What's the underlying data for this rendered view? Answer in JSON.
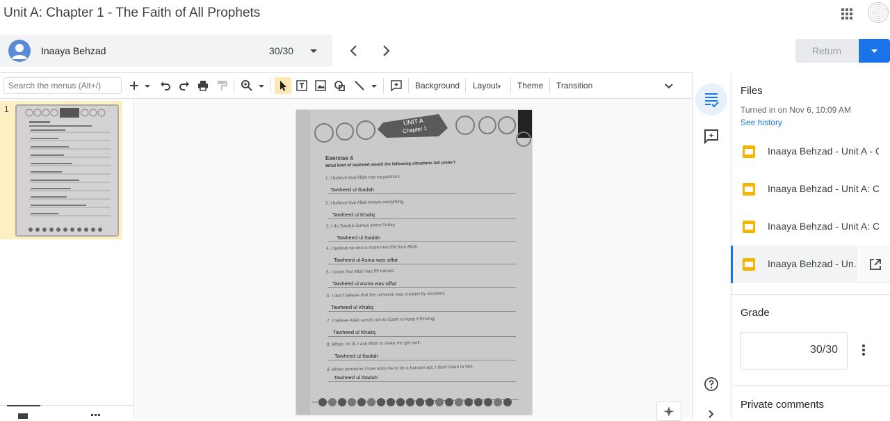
{
  "header": {
    "title": "Unit A: Chapter 1 - The Faith of All Prophets"
  },
  "student": {
    "name": "Inaaya Behzad",
    "score": "30/30"
  },
  "actions": {
    "return_label": "Return"
  },
  "toolbar": {
    "search_placeholder": "Search the menus (Alt+/)",
    "background": "Background",
    "layout": "Layout",
    "theme": "Theme",
    "transition": "Transition"
  },
  "filmstrip": {
    "slide_number": "1"
  },
  "worksheet": {
    "badge_line1": "UNIT A",
    "badge_line2": "Chapter 1",
    "exercise_title": "Exercise 4",
    "question": "What kind of tawheed would the following situations fall under?",
    "items": [
      {
        "q": "1. I believe that Allah has no partners.",
        "a": "Tawheed ul Ibadah"
      },
      {
        "q": "2. I believe that Allah knows everything.",
        "a": "Tawheed ul Khaliq"
      },
      {
        "q": "3. I do Salatul-Jumua every Friday.",
        "a": "Tawheed ul Ibadah"
      },
      {
        "q": "4. I believe no one is more merciful than Allah.",
        "a": "Tawheed ul Asma was siffat"
      },
      {
        "q": "5. I know that Allah has 99 names.",
        "a": "Tawheed ul Asma was siffat"
      },
      {
        "q": "6. I don't believe that the universe was created by accident.",
        "a": "Tawheed ul Khaliq"
      },
      {
        "q": "7. I believe Allah sends rain to Earth to keep it thriving.",
        "a": "Tawheed ul Khaliq"
      },
      {
        "q": "8. When I'm ill, I ask Allah to make me get well.",
        "a": "Tawheed ul Ibadah"
      },
      {
        "q": "9. When someone I love asks me to do a haraam act, I don't listen to him.",
        "a": "Tawheed ul Ibadah"
      }
    ]
  },
  "files_panel": {
    "title": "Files",
    "turned_in": "Turned in on Nov 6, 10:09 AM",
    "see_history": "See history",
    "files": [
      {
        "name": "Inaaya Behzad - Unit A - C..."
      },
      {
        "name": "Inaaya Behzad - Unit A: Ch..."
      },
      {
        "name": "Inaaya Behzad - Unit A: Ch..."
      },
      {
        "name": "Inaaya Behzad - Un..."
      }
    ]
  },
  "grade": {
    "title": "Grade",
    "value": "30/30"
  },
  "private_comments": {
    "title": "Private comments"
  },
  "colors": {
    "accent": "#1a73e8",
    "selected_slide_bg": "#feefc3",
    "slides_icon": "#f4b400"
  },
  "icons": [
    "apps-grid-icon",
    "account-avatar-icon",
    "chevron-left-icon",
    "chevron-right-icon",
    "dropdown-arrow-icon",
    "plus-icon",
    "undo-icon",
    "redo-icon",
    "print-icon",
    "paint-format-icon",
    "zoom-icon",
    "select-cursor-icon",
    "text-box-icon",
    "image-icon",
    "shape-icon",
    "line-icon",
    "comment-add-icon",
    "chevron-up-icon",
    "files-list-icon",
    "comments-icon",
    "help-icon",
    "slides-file-icon",
    "open-in-new-icon",
    "more-vert-icon"
  ]
}
